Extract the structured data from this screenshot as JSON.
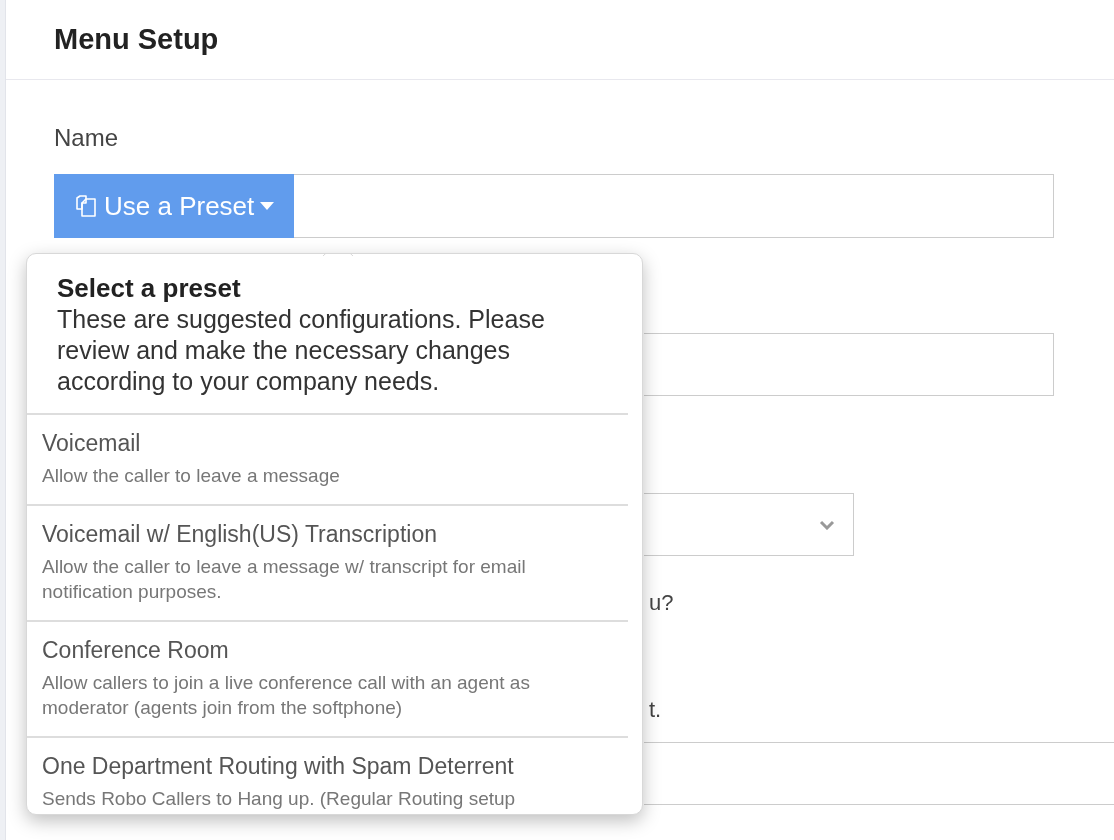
{
  "header": {
    "title": "Menu Setup"
  },
  "name_field": {
    "label": "Name",
    "preset_button": "Use a Preset"
  },
  "behind_fragments": [
    "u?",
    "t."
  ],
  "preset_popover": {
    "title": "Select a preset",
    "description": "These are suggested configurations. Please review and make the necessary changes according to your company needs.",
    "presets": [
      {
        "title": "Voicemail",
        "description": "Allow the caller to leave a message"
      },
      {
        "title": "Voicemail w/ English(US) Transcription",
        "description": "Allow the caller to leave a message w/ transcript for email notification purposes."
      },
      {
        "title": "Conference Room",
        "description": "Allow callers to join a live conference call with an agent as moderator (agents join from the softphone)"
      },
      {
        "title": "One Department Routing with Spam Deterrent",
        "description": "Sends Robo Callers to Hang up. (Regular Routing setup"
      }
    ]
  }
}
